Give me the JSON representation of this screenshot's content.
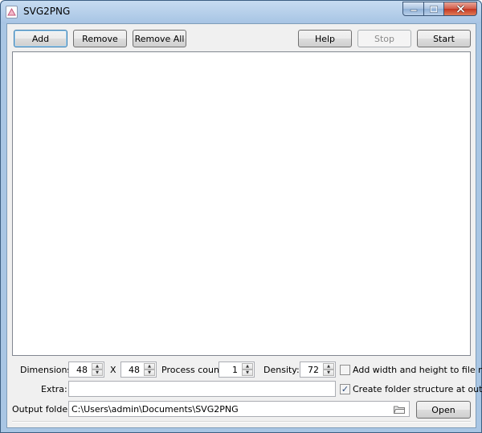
{
  "window": {
    "title": "SVG2PNG"
  },
  "toolbar": {
    "add_label": "Add",
    "remove_label": "Remove",
    "remove_all_label": "Remove All",
    "help_label": "Help",
    "stop_label": "Stop",
    "start_label": "Start"
  },
  "options": {
    "dimensions_label": "Dimensions:",
    "width_value": "48",
    "x_label": "X",
    "height_value": "48",
    "process_count_label": "Process count:",
    "process_count_value": "1",
    "density_label": "Density:",
    "density_value": "72",
    "add_wh_label": "Add width and height to file name",
    "add_wh_checked": false,
    "extra_label": "Extra:",
    "extra_value": "",
    "create_folder_label": "Create folder structure at output",
    "create_folder_checked": true,
    "output_folder_label": "Output folder:",
    "output_folder_value": "C:\\Users\\admin\\Documents\\SVG2PNG",
    "open_label": "Open"
  },
  "icons": {
    "app": "svg-file-icon",
    "folder": "folder-icon",
    "check": "✓"
  }
}
